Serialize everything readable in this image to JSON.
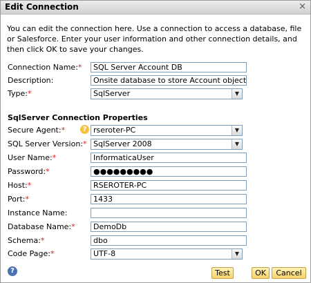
{
  "dialog": {
    "title": "Edit Connection",
    "close_glyph": "×",
    "intro": "You can edit the connection here. Use a connection to access a database, file or Salesforce. Enter your user information and other connection details, and then click OK to save your changes."
  },
  "general": {
    "connection_name": {
      "label": "Connection Name:",
      "required": "*",
      "value": "SQL Server Account DB"
    },
    "description": {
      "label": "Description:",
      "value": "Onsite database to store Account objects"
    },
    "type": {
      "label": "Type:",
      "required": "*",
      "value": "SqlServer"
    }
  },
  "section_title": "SqlServer Connection Properties",
  "props": {
    "secure_agent": {
      "label": "Secure Agent:",
      "required": "*",
      "value": "rseroter-PC",
      "info_glyph": "?"
    },
    "sql_version": {
      "label": "SQL Server Version:",
      "required": "*",
      "value": "SqlServer 2008"
    },
    "user_name": {
      "label": "User Name:",
      "required": "*",
      "value": "InformaticaUser"
    },
    "password": {
      "label": "Password:",
      "required": "*",
      "value": "●●●●●●●●●"
    },
    "host": {
      "label": "Host:",
      "required": "*",
      "value": "RSEROTER-PC"
    },
    "port": {
      "label": "Port:",
      "required": "*",
      "value": "1433"
    },
    "instance_name": {
      "label": "Instance Name:",
      "value": ""
    },
    "database_name": {
      "label": "Database Name:",
      "required": "*",
      "value": "DemoDb"
    },
    "schema": {
      "label": "Schema:",
      "required": "*",
      "value": "dbo"
    },
    "code_page": {
      "label": "Code Page:",
      "required": "*",
      "value": "UTF-8"
    }
  },
  "dropdown_glyph": "▼",
  "buttons": {
    "help_glyph": "?",
    "test": "Test",
    "ok": "OK",
    "cancel": "Cancel"
  },
  "colors": {
    "required": "#d11a1a",
    "button_gradient_top": "#fff1b5",
    "button_gradient_bottom": "#f7d36c",
    "info_icon": "#f5c242",
    "help_icon": "#4a72b0"
  }
}
